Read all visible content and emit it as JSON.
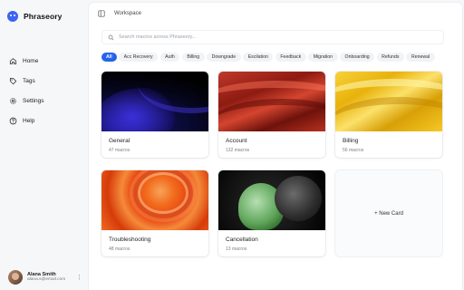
{
  "app": {
    "name": "Phraseory"
  },
  "sidebar": {
    "items": [
      {
        "label": "Home",
        "icon": "home-icon"
      },
      {
        "label": "Tags",
        "icon": "tag-icon"
      },
      {
        "label": "Settings",
        "icon": "gear-icon"
      },
      {
        "label": "Help",
        "icon": "help-icon"
      }
    ]
  },
  "user": {
    "name": "Alana Smith",
    "email": "alana.s@email.com",
    "menu": "⋮"
  },
  "header": {
    "breadcrumb": "Workspace"
  },
  "search": {
    "placeholder": "Search macros across Phraseory..."
  },
  "filters": [
    "All",
    "Acc Recovery",
    "Auth",
    "Billing",
    "Downgrade",
    "Escilation",
    "Feedback",
    "Migration",
    "Onboarding",
    "Refunds",
    "Renewal"
  ],
  "cards": [
    {
      "title": "General",
      "count": "47 macros"
    },
    {
      "title": "Account",
      "count": "132 macros"
    },
    {
      "title": "Billing",
      "count": "56 macros"
    },
    {
      "title": "Troubleshooting",
      "count": "48 macros"
    },
    {
      "title": "Cancellation",
      "count": "13 macros"
    }
  ],
  "new_card": {
    "label": "+ New Card"
  },
  "colors": {
    "accent": "#2563eb",
    "brand": "#3b63f4"
  }
}
